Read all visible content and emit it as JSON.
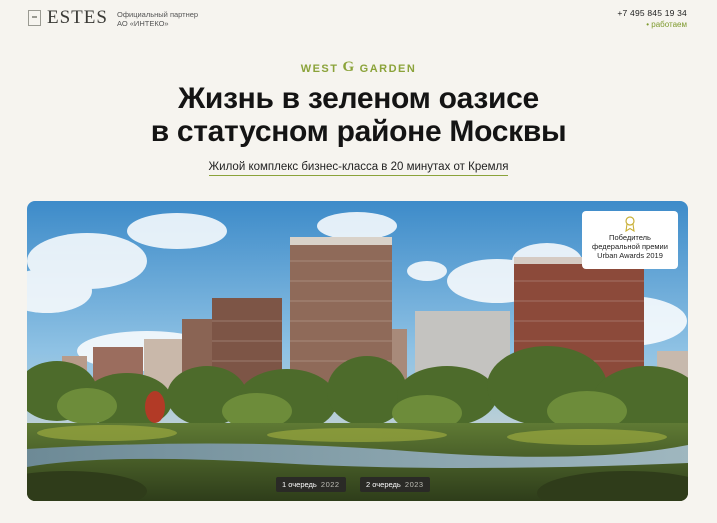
{
  "header": {
    "logo_text": "ESTES",
    "partner_line1": "Официальный партнер",
    "partner_line2": "АО «ИНТЕКО»",
    "phone": "+7 495 845 19 34",
    "status": "• работаем"
  },
  "hero": {
    "brand_left": "WEST",
    "brand_mark": "G",
    "brand_right": "GARDEN",
    "title_line1": "Жизнь в зеленом оазисе",
    "title_line2": "в статусном районе Москвы",
    "subtitle": "Жилой комплекс бизнес-класса в 20 минутах от Кремля"
  },
  "award": {
    "line1": "Победитель",
    "line2": "федеральной премии",
    "line3": "Urban Awards 2019",
    "icon": "award-medal-icon"
  },
  "phases": [
    {
      "label": "1 очередь",
      "year": "2022"
    },
    {
      "label": "2 очередь",
      "year": "2023"
    }
  ],
  "colors": {
    "accent": "#8ba33a",
    "background": "#f6f4ef"
  }
}
